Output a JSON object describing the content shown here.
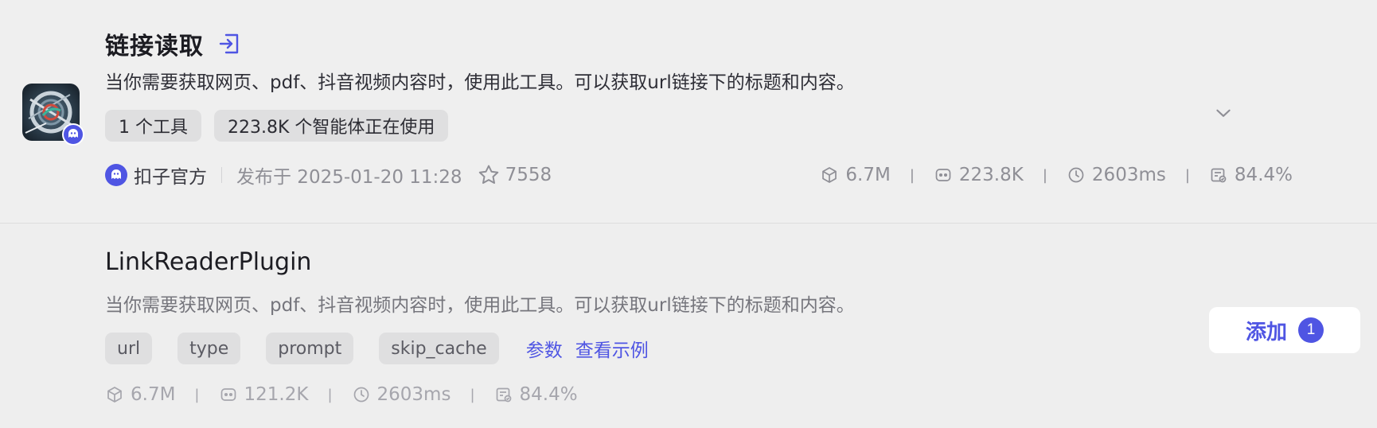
{
  "plugin": {
    "title": "链接读取",
    "description": "当你需要获取网页、pdf、抖音视频内容时，使用此工具。可以获取url链接下的标题和内容。",
    "tags": [
      "1 个工具",
      "223.8K 个智能体正在使用"
    ],
    "author": "扣子官方",
    "published": "发布于 2025-01-20 11:28",
    "favorites": "7558",
    "stats": {
      "calls": "6.7M",
      "bots": "223.8K",
      "latency": "2603ms",
      "success_rate": "84.4%"
    },
    "icons": {
      "open": "open-in-new-icon",
      "brand": "coze-mascot-icon",
      "favorite": "star-icon",
      "expand": "chevron-down-icon"
    },
    "accent_color": "#4f55e3"
  },
  "tool": {
    "name": "LinkReaderPlugin",
    "description": "当你需要获取网页、pdf、抖音视频内容时，使用此工具。可以获取url链接下的标题和内容。",
    "params": [
      "url",
      "type",
      "prompt",
      "skip_cache"
    ],
    "params_link": "参数",
    "example_link": "查看示例",
    "stats": {
      "calls": "6.7M",
      "bots": "121.2K",
      "latency": "2603ms",
      "success_rate": "84.4%"
    },
    "add_button": {
      "label": "添加",
      "count": "1"
    }
  }
}
